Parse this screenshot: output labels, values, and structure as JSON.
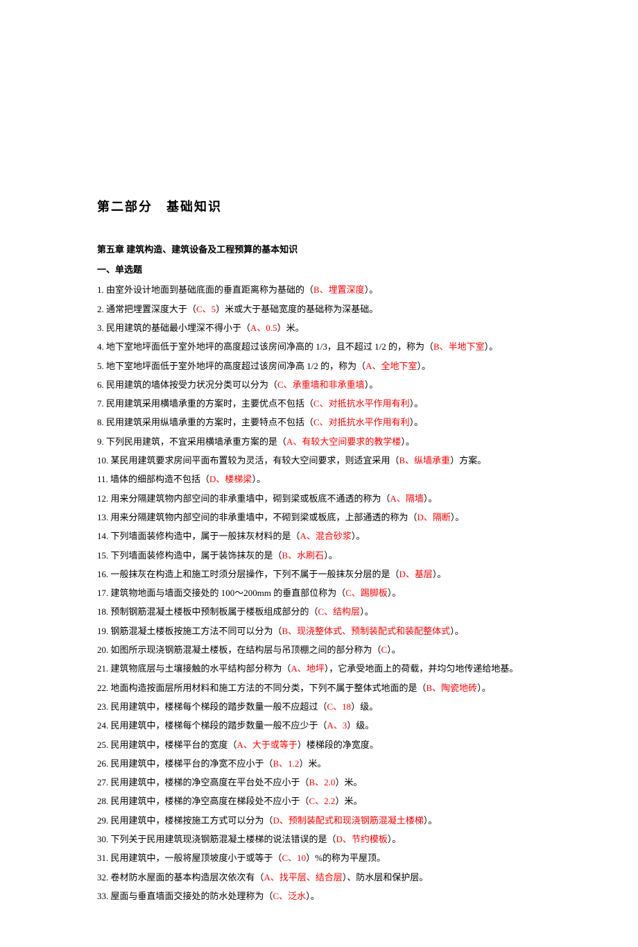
{
  "part_title_a": "第二部分",
  "part_title_b": "基础知识",
  "chapter_title": "第五章 建筑构造、建筑设备及工程预算的基本知识",
  "section_title": "一、单选题",
  "questions": [
    {
      "num": "1.",
      "pre": "由室外设计地面到基础底面的垂直距离称为基础的（",
      "ans": "B、埋置深度",
      "post": "）。"
    },
    {
      "num": "2.",
      "pre": "通常把埋置深度大于（",
      "ans": "C、5",
      "post": "）米或大于基础宽度的基础称为深基础。"
    },
    {
      "num": "3.",
      "pre": "民用建筑的基础最小埋深不得小于（",
      "ans": "A、0.5",
      "post": "）米。"
    },
    {
      "num": "4.",
      "pre": "地下室地坪面低于室外地坪的高度超过该房间净高的 1/3，且不超过 1/2 的，称为（",
      "ans": "B、半地下室",
      "post": "）。"
    },
    {
      "num": "5.",
      "pre": "地下室地坪面低于室外地坪的高度超过该房间净高 1/2 的，称为（",
      "ans": "A、全地下室",
      "post": "）。"
    },
    {
      "num": "6.",
      "pre": "民用建筑的墙体按受力状况分类可以分为（",
      "ans": "C、承重墙和非承重墙",
      "post": "）。"
    },
    {
      "num": "7.",
      "pre": "民用建筑采用横墙承重的方案时，主要优点不包括（",
      "ans": "C、对抵抗水平作用有利",
      "post": "）。"
    },
    {
      "num": "8.",
      "pre": "民用建筑采用纵墙承重的方案时，主要特点不包括（",
      "ans": "C、对抵抗水平作用有利",
      "post": "）。"
    },
    {
      "num": "9.",
      "pre": "下列民用建筑，不宜采用横墙承重方案的是（",
      "ans": "A、有较大空间要求的教学楼",
      "post": "）。"
    },
    {
      "num": "10.",
      "pre": "某民用建筑要求房间平面布置较为灵活，有较大空间要求，则适宜采用（",
      "ans": "B、纵墙承重",
      "post": "）方案。"
    },
    {
      "num": "11.",
      "pre": "墙体的细部构造不包括（",
      "ans": "D、楼梯梁",
      "post": "）。"
    },
    {
      "num": "12.",
      "pre": "用来分隔建筑物内部空间的非承重墙中，砌到梁或板底不通透的称为（",
      "ans": "A、隔墙",
      "post": "）。"
    },
    {
      "num": "13.",
      "pre": "用来分隔建筑物内部空间的非承重墙中，不砌到梁或板底，上部通透的称为（",
      "ans": "D、隔断",
      "post": "）。"
    },
    {
      "num": "14.",
      "pre": "下列墙面装修构造中，属于一般抹灰材料的是（",
      "ans": "A、混合砂浆",
      "post": "）。"
    },
    {
      "num": "15.",
      "pre": "下列墙面装修构造中，属于装饰抹灰的是（",
      "ans": "B、水刷石",
      "post": "）。"
    },
    {
      "num": "16.",
      "pre": "一般抹灰在构造上和施工时须分层操作，下列不属于一般抹灰分层的是（",
      "ans": "D、基层",
      "post": "）。"
    },
    {
      "num": "17.",
      "pre": "建筑物地面与墙面交接处的 100～200mm 的垂直部位称为（",
      "ans": "C、踢脚板",
      "post": "）。"
    },
    {
      "num": "18.",
      "pre": "预制钢筋混凝土楼板中预制板属于楼板组成部分的（",
      "ans": "C、结构层",
      "post": "）。"
    },
    {
      "num": "19.",
      "pre": "钢筋混凝土楼板按施工方法不同可以分为（",
      "ans": "B、现浇整体式、预制装配式和装配整体式",
      "post": "）。"
    },
    {
      "num": "20.",
      "pre": "如图所示现浇钢筋混凝土楼板，在结构层与吊顶棚之间的部分称为（",
      "ans": "C",
      "post": "）。"
    },
    {
      "num": "21.",
      "pre": "建筑物底层与土壤接触的水平结构部分称为（",
      "ans": "A、地坪",
      "post": "），它承受地面上的荷载，并均匀地传递给地基。"
    },
    {
      "num": "22.",
      "pre": "地面构造按面层所用材料和施工方法的不同分类，下列不属于整体式地面的是（",
      "ans": "B、陶瓷地砖",
      "post": "）。"
    },
    {
      "num": "23.",
      "pre": "民用建筑中，楼梯每个梯段的踏步数量一般不应超过（",
      "ans": "C、18",
      "post": "）级。"
    },
    {
      "num": "24.",
      "pre": "民用建筑中，楼梯每个梯段的踏步数量一般不应少于（",
      "ans": "A、3",
      "post": "）级。"
    },
    {
      "num": "25.",
      "pre": "民用建筑中，楼梯平台的宽度（",
      "ans": "A、大于或等于",
      "post": "）楼梯段的净宽度。"
    },
    {
      "num": "26.",
      "pre": "民用建筑中，楼梯平台的净宽不应小于（",
      "ans": "B、1.2",
      "post": "）米。"
    },
    {
      "num": "27.",
      "pre": "民用建筑中，楼梯的净空高度在平台处不应小于（",
      "ans": "B、2.0",
      "post": "）米。"
    },
    {
      "num": "28.",
      "pre": "民用建筑中，楼梯的净空高度在梯段处不应小于（",
      "ans": "C、2.2",
      "post": "）米。"
    },
    {
      "num": "29.",
      "pre": "民用建筑中，楼梯按施工方式可以分为（",
      "ans": "D、预制装配式和现浇钢筋混凝土楼梯",
      "post": "）。"
    },
    {
      "num": "30.",
      "pre": "下列关于民用建筑现浇钢筋混凝土楼梯的说法错误的是（",
      "ans": "D、节约模板",
      "post": "）。"
    },
    {
      "num": "31.",
      "pre": "民用建筑中，一般将屋顶坡度小于或等于（",
      "ans": "C、10",
      "post": "）%的称为平屋顶。"
    },
    {
      "num": "32.",
      "pre": "卷材防水屋面的基本构造层次依次有（",
      "ans": "A、找平层、结合层",
      "post": "）、防水层和保护层。"
    },
    {
      "num": "33.",
      "pre": "屋面与垂直墙面交接处的防水处理称为（",
      "ans": "C、泛水",
      "post": "）。"
    }
  ]
}
